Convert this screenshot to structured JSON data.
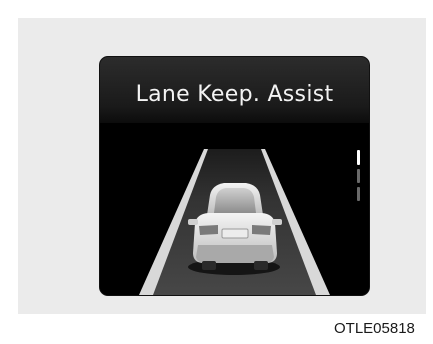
{
  "display": {
    "title": "Lane Keep. Assist",
    "icons": {
      "vehicle": "car-rear-icon",
      "lane_level": "lane-level-indicator"
    },
    "colors": {
      "screen_bg": "#000000",
      "road": "#3a3a3a",
      "lane_markings": "#d8d8d8",
      "text": "#f3f3f3"
    }
  },
  "figure_code": "OTLE05818"
}
